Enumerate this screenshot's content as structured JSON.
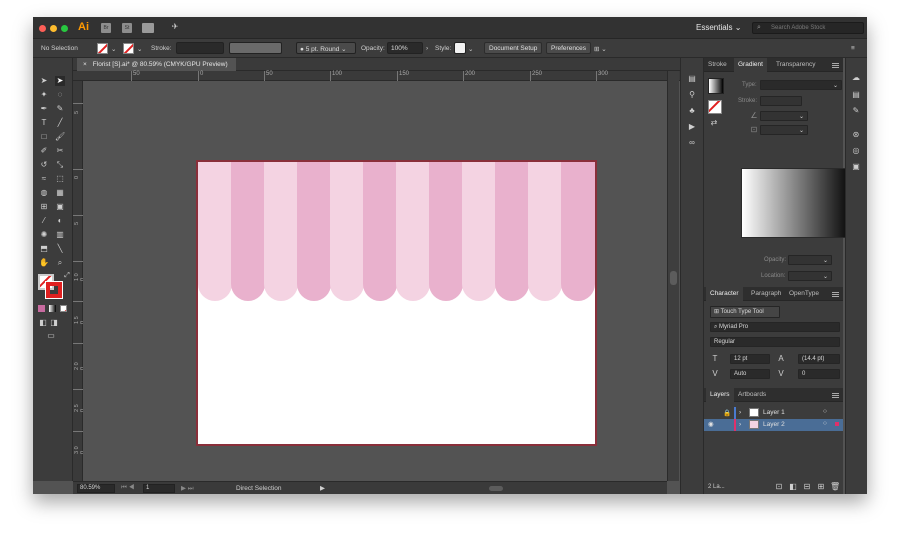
{
  "app": {
    "logo": "Ai",
    "bridge": "Br",
    "stock": "St",
    "workspace": "Essentials",
    "search_placeholder": "Search Adobe Stock"
  },
  "control_bar": {
    "selection": "No Selection",
    "stroke_label": "Stroke:",
    "brush": "5 pt. Round",
    "opacity_label": "Opacity:",
    "opacity_value": "100%",
    "style_label": "Style:",
    "document_setup": "Document Setup",
    "preferences": "Preferences"
  },
  "document": {
    "tab_title": "Florist [S].ai* @ 80.59% (CMYK/GPU Preview)",
    "close": "×",
    "zoom": "80.59%",
    "artboard_number": "1",
    "status_tool": "Direct Selection"
  },
  "ruler": {
    "h_labels": [
      "50",
      "0",
      "50",
      "100",
      "150",
      "200",
      "250",
      "300"
    ],
    "v_labels": [
      "5",
      "0",
      "5",
      "1 0 0",
      "1 5 0",
      "2 0 0",
      "2 5 0",
      "3 0 0"
    ]
  },
  "artwork": {
    "stripe_light": "#f4d3e2",
    "stripe_dark": "#e9b1cd"
  },
  "gradient_panel": {
    "tabs": [
      "Stroke",
      "Gradient",
      "Transparency"
    ],
    "type_label": "Type:",
    "stroke_label": "Stroke:",
    "opacity_label": "Opacity:",
    "location_label": "Location:"
  },
  "character_panel": {
    "tabs": [
      "Character",
      "Paragraph",
      "OpenType"
    ],
    "touch_type": "Touch Type Tool",
    "font": "Myriad Pro",
    "style": "Regular",
    "size": "12 pt",
    "leading": "(14.4 pt)",
    "kerning": "Auto",
    "tracking": "0"
  },
  "layers_panel": {
    "tabs": [
      "Layers",
      "Artboards"
    ],
    "layers": [
      {
        "name": "Layer 1",
        "color": "#4a7bd0"
      },
      {
        "name": "Layer 2",
        "color": "#e0306a"
      }
    ],
    "count": "2 La..."
  }
}
